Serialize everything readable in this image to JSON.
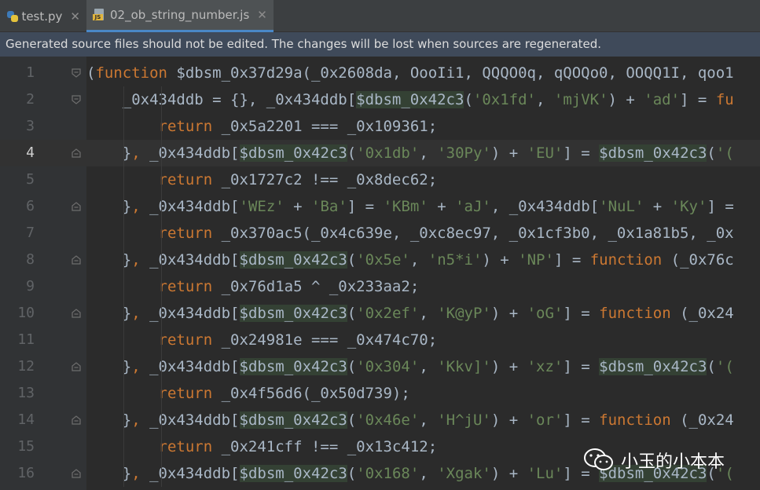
{
  "tabs": [
    {
      "label": "test.py",
      "icon": "python-file-icon",
      "active": false
    },
    {
      "label": "02_ob_string_number.js",
      "icon": "javascript-file-icon",
      "active": true
    }
  ],
  "banner": {
    "text": "Generated source files should not be edited. The changes will be lost when sources are regenerated."
  },
  "lines": [
    {
      "n": "1",
      "parts": [
        [
          "p",
          "("
        ],
        [
          "k",
          "function"
        ],
        [
          "p",
          " $dbsm_0x37d29a(_0x2608da, OooIi1, QQQO0q, qQOQo0, OOQQ1I, qoo1"
        ]
      ]
    },
    {
      "n": "2",
      "parts": [
        [
          "p",
          "    _0x434ddb = {}, _0x434ddb["
        ],
        [
          "h",
          "$dbsm_0x42c3"
        ],
        [
          "p",
          "("
        ],
        [
          "s",
          "'0x1fd'"
        ],
        [
          "p",
          ", "
        ],
        [
          "s",
          "'mjVK'"
        ],
        [
          "p",
          ") + "
        ],
        [
          "s",
          "'ad'"
        ],
        [
          "p",
          "] = "
        ],
        [
          "k",
          "fu"
        ]
      ]
    },
    {
      "n": "3",
      "parts": [
        [
          "p",
          "        "
        ],
        [
          "k",
          "return"
        ],
        [
          "p",
          " _0x5a2201 === _0x109361;"
        ]
      ]
    },
    {
      "n": "4",
      "parts": [
        [
          "p",
          "    }"
        ],
        [
          "k",
          ","
        ],
        [
          "p",
          " _0x434ddb["
        ],
        [
          "h",
          "$dbsm_0x42c3"
        ],
        [
          "p",
          "("
        ],
        [
          "s",
          "'0x1db'"
        ],
        [
          "p",
          ", "
        ],
        [
          "s",
          "'30Py'"
        ],
        [
          "p",
          ") + "
        ],
        [
          "s",
          "'EU'"
        ],
        [
          "p",
          "] = "
        ],
        [
          "h",
          "$dbsm_0x42c3"
        ],
        [
          "p",
          "("
        ],
        [
          "s",
          "'("
        ]
      ]
    },
    {
      "n": "5",
      "parts": [
        [
          "p",
          "        "
        ],
        [
          "k",
          "return"
        ],
        [
          "p",
          " _0x1727c2 !== _0x8dec62;"
        ]
      ]
    },
    {
      "n": "6",
      "parts": [
        [
          "p",
          "    }"
        ],
        [
          "k",
          ","
        ],
        [
          "p",
          " _0x434ddb["
        ],
        [
          "s",
          "'WEz'"
        ],
        [
          "p",
          " + "
        ],
        [
          "s",
          "'Ba'"
        ],
        [
          "p",
          "] = "
        ],
        [
          "s",
          "'KBm'"
        ],
        [
          "p",
          " + "
        ],
        [
          "s",
          "'aJ'"
        ],
        [
          "p",
          ", _0x434ddb["
        ],
        [
          "s",
          "'NuL'"
        ],
        [
          "p",
          " + "
        ],
        [
          "s",
          "'Ky'"
        ],
        [
          "p",
          "] ="
        ]
      ]
    },
    {
      "n": "7",
      "parts": [
        [
          "p",
          "        "
        ],
        [
          "k",
          "return"
        ],
        [
          "p",
          " _0x370ac5(_0x4c639e, _0xc8ec97, _0x1cf3b0, _0x1a81b5, _0x"
        ]
      ]
    },
    {
      "n": "8",
      "parts": [
        [
          "p",
          "    }"
        ],
        [
          "k",
          ","
        ],
        [
          "p",
          " _0x434ddb["
        ],
        [
          "h",
          "$dbsm_0x42c3"
        ],
        [
          "p",
          "("
        ],
        [
          "s",
          "'0x5e'"
        ],
        [
          "p",
          ", "
        ],
        [
          "s",
          "'n5*i'"
        ],
        [
          "p",
          ") + "
        ],
        [
          "s",
          "'NP'"
        ],
        [
          "p",
          "] = "
        ],
        [
          "k",
          "function"
        ],
        [
          "p",
          " (_0x76c"
        ]
      ]
    },
    {
      "n": "9",
      "parts": [
        [
          "p",
          "        "
        ],
        [
          "k",
          "return"
        ],
        [
          "p",
          " _0x76d1a5 ^ _0x233aa2;"
        ]
      ]
    },
    {
      "n": "10",
      "parts": [
        [
          "p",
          "    }"
        ],
        [
          "k",
          ","
        ],
        [
          "p",
          " _0x434ddb["
        ],
        [
          "h",
          "$dbsm_0x42c3"
        ],
        [
          "p",
          "("
        ],
        [
          "s",
          "'0x2ef'"
        ],
        [
          "p",
          ", "
        ],
        [
          "s",
          "'K@yP'"
        ],
        [
          "p",
          ") + "
        ],
        [
          "s",
          "'oG'"
        ],
        [
          "p",
          "] = "
        ],
        [
          "k",
          "function"
        ],
        [
          "p",
          " (_0x24"
        ]
      ]
    },
    {
      "n": "11",
      "parts": [
        [
          "p",
          "        "
        ],
        [
          "k",
          "return"
        ],
        [
          "p",
          " _0x24981e === _0x474c70;"
        ]
      ]
    },
    {
      "n": "12",
      "parts": [
        [
          "p",
          "    }"
        ],
        [
          "k",
          ","
        ],
        [
          "p",
          " _0x434ddb["
        ],
        [
          "h",
          "$dbsm_0x42c3"
        ],
        [
          "p",
          "("
        ],
        [
          "s",
          "'0x304'"
        ],
        [
          "p",
          ", "
        ],
        [
          "s",
          "'Kkv]'"
        ],
        [
          "p",
          ") + "
        ],
        [
          "s",
          "'xz'"
        ],
        [
          "p",
          "] = "
        ],
        [
          "h",
          "$dbsm_0x42c3"
        ],
        [
          "p",
          "("
        ],
        [
          "s",
          "'("
        ]
      ]
    },
    {
      "n": "13",
      "parts": [
        [
          "p",
          "        "
        ],
        [
          "k",
          "return"
        ],
        [
          "p",
          " _0x4f56d6(_0x50d739);"
        ]
      ]
    },
    {
      "n": "14",
      "parts": [
        [
          "p",
          "    }"
        ],
        [
          "k",
          ","
        ],
        [
          "p",
          " _0x434ddb["
        ],
        [
          "h",
          "$dbsm_0x42c3"
        ],
        [
          "p",
          "("
        ],
        [
          "s",
          "'0x46e'"
        ],
        [
          "p",
          ", "
        ],
        [
          "s",
          "'H^jU'"
        ],
        [
          "p",
          ") + "
        ],
        [
          "s",
          "'or'"
        ],
        [
          "p",
          "] = "
        ],
        [
          "k",
          "function"
        ],
        [
          "p",
          " (_0x24"
        ]
      ]
    },
    {
      "n": "15",
      "parts": [
        [
          "p",
          "        "
        ],
        [
          "k",
          "return"
        ],
        [
          "p",
          " _0x241cff !== _0x13c412;"
        ]
      ]
    },
    {
      "n": "16",
      "parts": [
        [
          "p",
          "    }"
        ],
        [
          "k",
          ","
        ],
        [
          "p",
          " _0x434ddb["
        ],
        [
          "h",
          "$dbsm_0x42c3"
        ],
        [
          "p",
          "("
        ],
        [
          "s",
          "'0x168'"
        ],
        [
          "p",
          ", "
        ],
        [
          "s",
          "'Xgak'"
        ],
        [
          "p",
          ") + "
        ],
        [
          "s",
          "'Lu'"
        ],
        [
          "p",
          "] = "
        ],
        [
          "h",
          "$dbsm_0x42c3"
        ],
        [
          "p",
          "("
        ],
        [
          "s",
          "'("
        ]
      ]
    }
  ],
  "current_line": "4",
  "watermark": {
    "text": "小玉的小本本",
    "icon": "wechat-icon"
  },
  "colors": {
    "keyword": "#cc7832",
    "string": "#6a8759",
    "plain": "#a9b7c6",
    "highlight": "#344134",
    "banner": "#3f4a5a",
    "tab_underline": "#4a88c7"
  }
}
